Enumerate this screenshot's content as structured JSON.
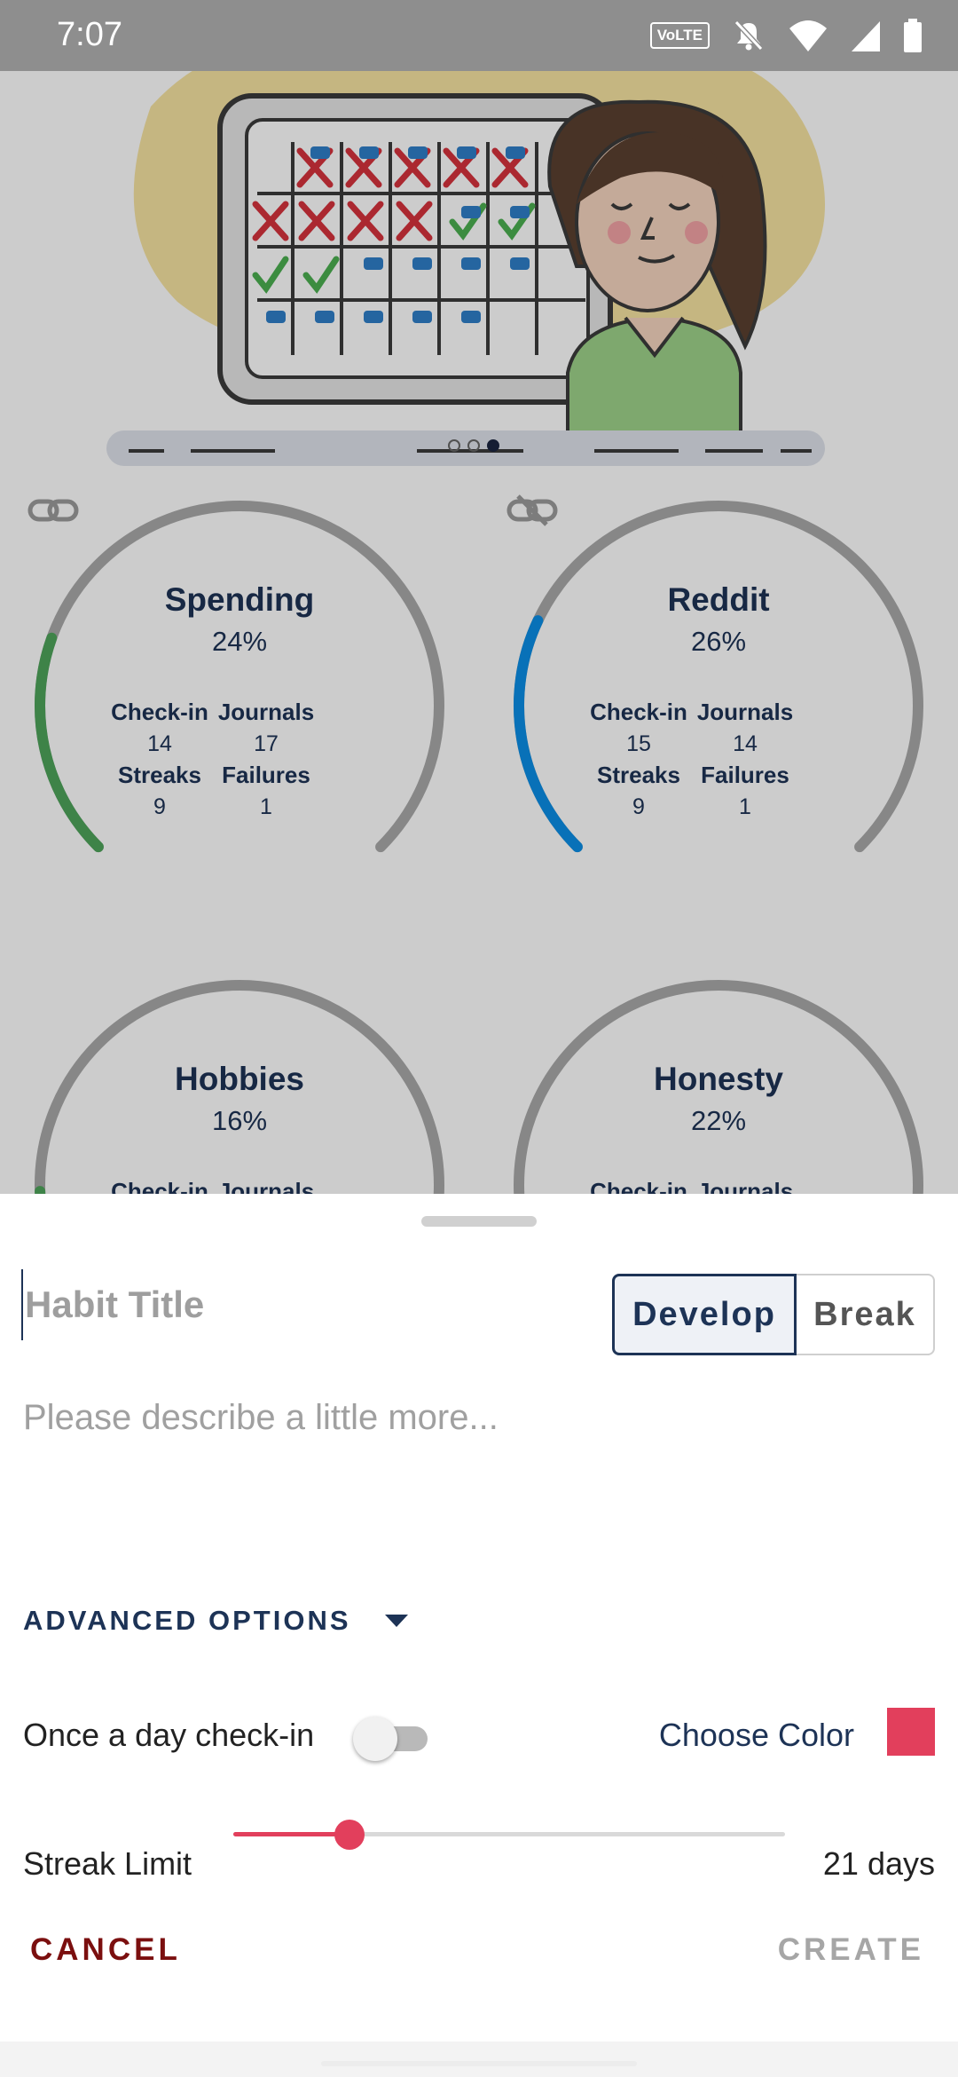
{
  "status_bar": {
    "time": "7:07",
    "network_badge": "VoLTE",
    "icons": [
      "volte-icon",
      "mute-icon",
      "wifi-icon",
      "signal-icon",
      "battery-icon"
    ]
  },
  "pager": {
    "total_pages": 3,
    "active_index": 2
  },
  "habits": [
    {
      "name": "Spending",
      "percent": "24%",
      "checkin_label": "Check-in",
      "checkin": "14",
      "journals_label": "Journals",
      "journals": "17",
      "streaks_label": "Streaks",
      "streaks": "9",
      "failures_label": "Failures",
      "failures": "1",
      "progress": 0.24,
      "color": "#4ea45b",
      "link_icon": "link-icon"
    },
    {
      "name": "Reddit",
      "percent": "26%",
      "checkin_label": "Check-in",
      "checkin": "15",
      "journals_label": "Journals",
      "journals": "14",
      "streaks_label": "Streaks",
      "streaks": "9",
      "failures_label": "Failures",
      "failures": "1",
      "progress": 0.26,
      "color": "#0b8ee6",
      "link_icon": "unlink-icon"
    },
    {
      "name": "Hobbies",
      "percent": "16%",
      "checkin_label": "Check-in",
      "journals_label": "Journals",
      "progress": 0.16,
      "color": "#4ea45b"
    },
    {
      "name": "Honesty",
      "percent": "22%",
      "checkin_label": "Check-in",
      "journals_label": "Journals",
      "progress": 0.04,
      "color": "#6a3fbf"
    }
  ],
  "sheet": {
    "title_placeholder": "Habit Title",
    "type_options": [
      "Develop",
      "Break"
    ],
    "type_selected": "Develop",
    "description_placeholder": "Please describe a little more...",
    "advanced_label": "ADVANCED OPTIONS",
    "once_a_day_label": "Once a day check-in",
    "once_a_day_enabled": false,
    "choose_color_label": "Choose Color",
    "selected_color": "#e23f5c",
    "streak_limit_label": "Streak Limit",
    "streak_limit_value": "21 days",
    "streak_limit_fraction": 0.21,
    "cancel_label": "CANCEL",
    "create_label": "CREATE"
  },
  "colors": {
    "navy": "#1d3356",
    "accent_red": "#e23f5c",
    "cancel_red": "#7b0f0f",
    "ring_gray": "#a9a9a9"
  }
}
